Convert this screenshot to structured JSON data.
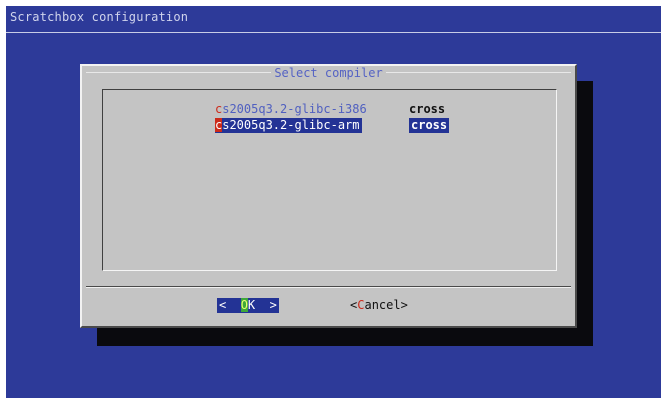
{
  "backtitle": "Scratchbox configuration",
  "dialog": {
    "title": "Select compiler",
    "items": [
      {
        "tag_hotkey": "c",
        "tag_rest": "s2005q3.2-glibc-i386",
        "description": "cross",
        "selected": false
      },
      {
        "tag_hotkey": "c",
        "tag_rest": "s2005q3.2-glibc-arm",
        "description": "cross",
        "selected": true
      }
    ],
    "ok": {
      "left": "<  ",
      "hotkey": "O",
      "rest": "K  >"
    },
    "cancel": {
      "left": "<",
      "hotkey": "C",
      "rest": "ancel>"
    }
  },
  "colors": {
    "background": "#2d3a99",
    "dialog": "#c4c4c4",
    "highlight": "#233395",
    "hotkey": "#cc2a1a"
  }
}
